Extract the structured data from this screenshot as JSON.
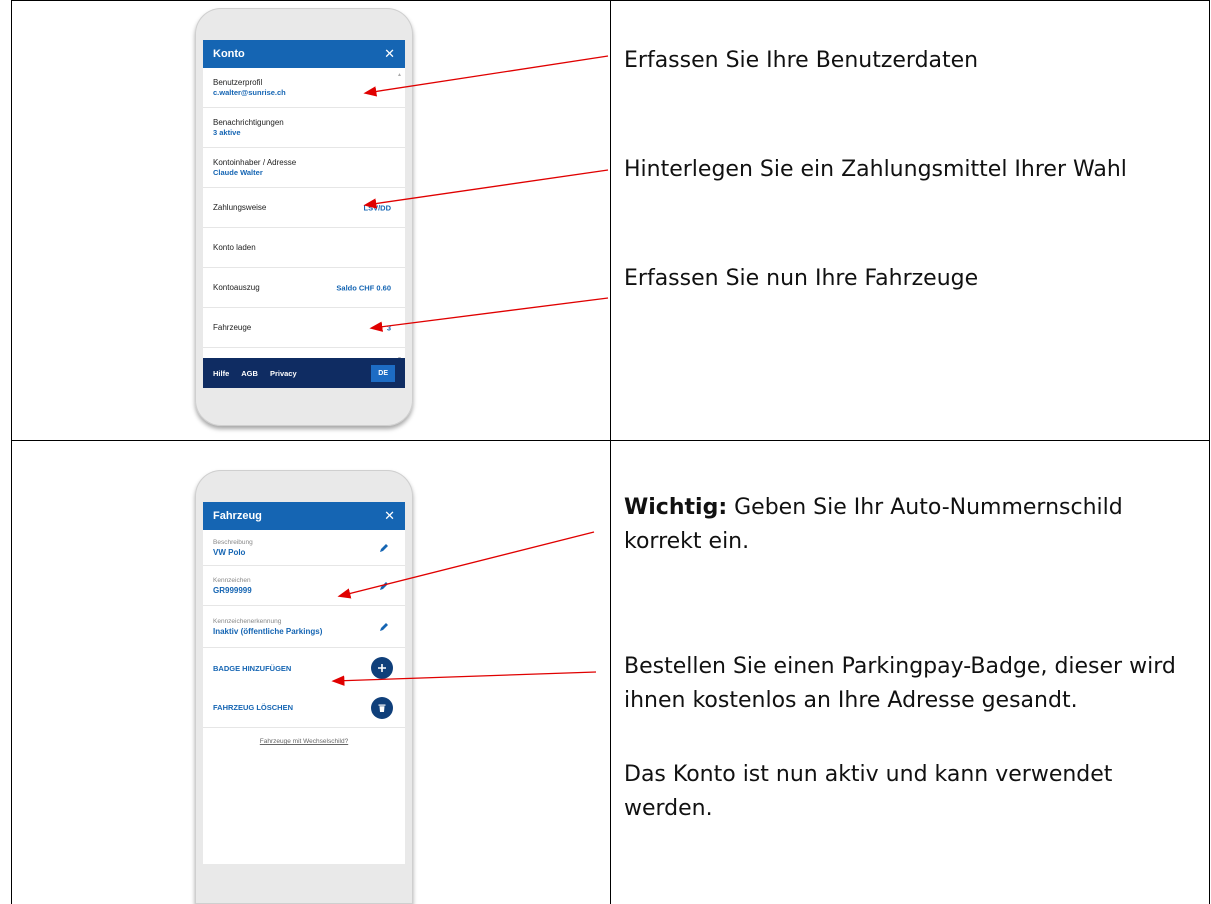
{
  "rows": [
    {
      "phone": {
        "header_title": "Konto",
        "close_glyph": "✕",
        "items": [
          {
            "label": "Benutzerprofil",
            "value": "c.walter@sunrise.ch"
          },
          {
            "label": "Benachrichtigungen",
            "value": "3 aktive"
          },
          {
            "label": "Kontoinhaber / Adresse",
            "value": "Claude Walter"
          },
          {
            "label": "Zahlungsweise",
            "right": "LSV/DD"
          },
          {
            "label": "Konto laden"
          },
          {
            "label": "Kontoauszug",
            "right": "Saldo CHF 0.60"
          },
          {
            "label": "Fahrzeuge",
            "right": "3"
          }
        ],
        "footer": {
          "help": "Hilfe",
          "agb": "AGB",
          "privacy": "Privacy",
          "lang": "DE"
        }
      },
      "instructions": [
        "Erfassen Sie Ihre Benutzerdaten",
        "Hinterlegen Sie ein Zahlungsmittel Ihrer Wahl",
        "Erfassen Sie nun Ihre Fahrzeuge"
      ]
    },
    {
      "phone": {
        "header_title": "Fahrzeug",
        "close_glyph": "✕",
        "items": [
          {
            "label": "Beschreibung",
            "value": "VW Polo"
          },
          {
            "label": "Kennzeichen",
            "value": "GR999999"
          },
          {
            "label": "Kennzeichenerkennung",
            "value": "Inaktiv (öffentliche Parkings)"
          }
        ],
        "actions": [
          {
            "label": "BADGE HINZUFÜGEN",
            "icon": "plus-icon"
          },
          {
            "label": "FAHRZEUG LÖSCHEN",
            "icon": "trash-icon"
          }
        ],
        "link": "Fahrzeuge mit Wechselschild?"
      },
      "instructions": {
        "important_label": "Wichtig:",
        "important_text": " Geben Sie Ihr Auto-Nummernschild korrekt ein.",
        "badge_text": "Bestellen Sie einen Parkingpay-Badge, dieser wird ihnen kostenlos an Ihre Adresse gesandt.",
        "active_text": "Das Konto ist nun aktiv und kann verwendet werden."
      }
    }
  ],
  "colors": {
    "app_blue": "#1565b3",
    "footer_navy": "#0f2c62",
    "arrow_red": "#e00000"
  }
}
